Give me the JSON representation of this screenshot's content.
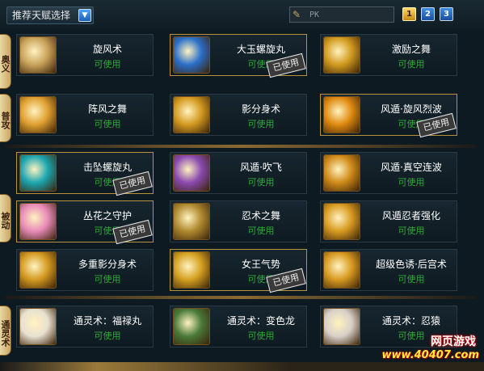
{
  "topbar": {
    "preset_label": "推荐天赋选择",
    "search_value": "PK",
    "pages": [
      "1",
      "2",
      "3"
    ],
    "active_page": "1"
  },
  "sections": [
    {
      "label": "奥义"
    },
    {
      "label": "普攻"
    },
    {
      "label": "被动"
    },
    {
      "label": "通灵术"
    }
  ],
  "status_available": "可使用",
  "status_used": "已使用",
  "skills": [
    {
      "name": "旋风术",
      "owned": false,
      "icon": "tornado-icon",
      "color": "#c9a35a"
    },
    {
      "name": "大玉螺旋丸",
      "owned": true,
      "icon": "rasengan-icon",
      "color": "#2a6fc9"
    },
    {
      "name": "激励之舞",
      "owned": false,
      "icon": "dance-icon",
      "color": "#d19a1e"
    },
    {
      "name": "阵风之舞",
      "owned": false,
      "icon": "gust-icon",
      "color": "#e0a030"
    },
    {
      "name": "影分身术",
      "owned": false,
      "icon": "clone-icon",
      "color": "#d49a20"
    },
    {
      "name": "风遁·旋风烈波",
      "owned": true,
      "icon": "wind-wave-icon",
      "color": "#e08a10"
    },
    {
      "name": "击坠螺旋丸",
      "owned": true,
      "icon": "rasengan-drop-icon",
      "color": "#1aa6b0"
    },
    {
      "name": "风遁·吹飞",
      "owned": false,
      "icon": "fan-icon",
      "color": "#8a4ab0"
    },
    {
      "name": "风遁·真空连波",
      "owned": false,
      "icon": "vacuum-icon",
      "color": "#d08a18"
    },
    {
      "name": "丛花之守护",
      "owned": true,
      "icon": "flower-guard-icon",
      "color": "#e88ab8"
    },
    {
      "name": "忍术之舞",
      "owned": false,
      "icon": "scroll-icon",
      "color": "#b08a30"
    },
    {
      "name": "风遁忍者强化",
      "owned": false,
      "icon": "wind-kanji-icon",
      "color": "#d89a20"
    },
    {
      "name": "多重影分身术",
      "owned": false,
      "icon": "multi-clone-icon",
      "color": "#d49a20"
    },
    {
      "name": "女王气势",
      "owned": true,
      "icon": "queen-icon",
      "color": "#d4a020"
    },
    {
      "name": "超级色诱·后宫术",
      "owned": false,
      "icon": "harem-icon",
      "color": "#d89a20"
    },
    {
      "name": "通灵术：福禄丸",
      "owned": false,
      "icon": "cat-summon-icon",
      "color": "#e8e0d0"
    },
    {
      "name": "通灵术：变色龙",
      "owned": false,
      "icon": "chameleon-icon",
      "color": "#4a7a3a"
    },
    {
      "name": "通灵术：忍猿",
      "owned": false,
      "icon": "monkey-icon",
      "color": "#d8d0c8"
    }
  ],
  "watermark": {
    "line1": "网页游戏",
    "line2": "www.40407.com"
  }
}
